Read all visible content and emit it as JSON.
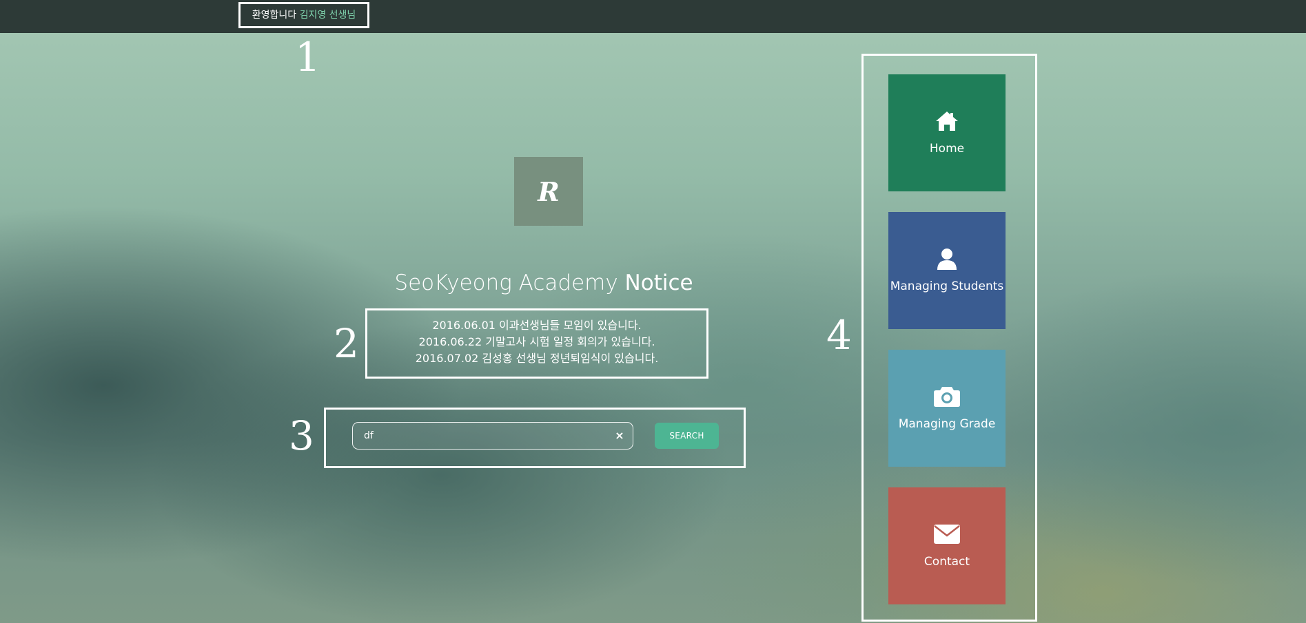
{
  "topbar": {
    "welcome_text": "환영합니다",
    "teacher_name": "김지영 선생님"
  },
  "annotations": [
    "1",
    "2",
    "3",
    "4"
  ],
  "logo": {
    "glyph": "R"
  },
  "notice": {
    "title_prefix": "SeoKyeong Academy",
    "title_bold": "Notice",
    "items": [
      "2016.06.01 이과선생님들 모임이 있습니다.",
      "2016.06.22 기말고사 시험 일정 회의가 있습니다.",
      "2016.07.02 김성홍 선생님 정년퇴임식이 있습니다."
    ]
  },
  "search": {
    "value": "df",
    "clear_label": "×",
    "button_label": "SEARCH"
  },
  "menu": {
    "items": [
      {
        "label": "Home",
        "icon": "home-icon",
        "color": "#1f7e59"
      },
      {
        "label": "Managing Students",
        "icon": "user-icon",
        "color": "#3a5c91"
      },
      {
        "label": "Managing Grade",
        "icon": "camera-icon",
        "color": "#5ba0b1"
      },
      {
        "label": "Contact",
        "icon": "envelope-icon",
        "color": "#b95c52"
      }
    ]
  }
}
